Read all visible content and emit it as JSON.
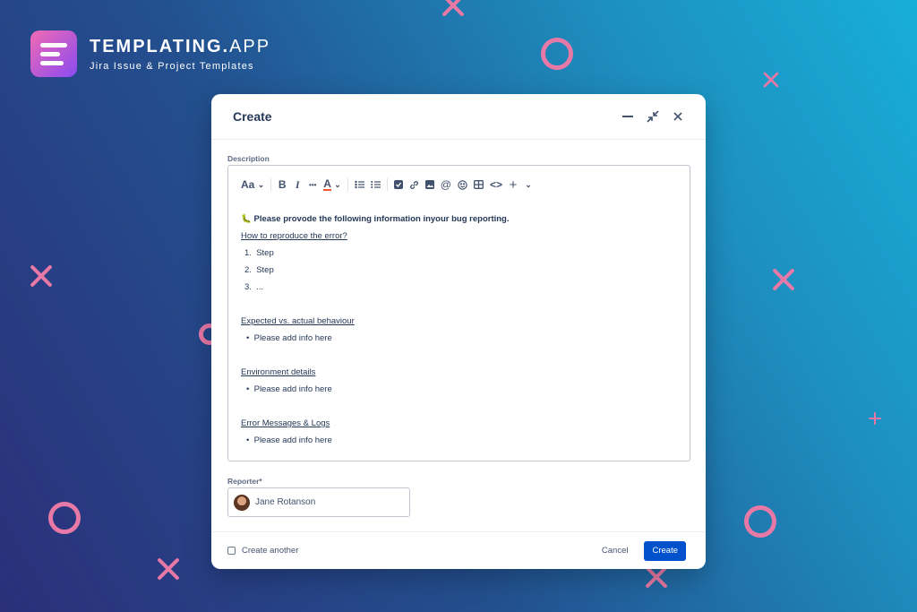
{
  "brand": {
    "name_bold": "TEMPLATING.",
    "name_light": "APP",
    "subtitle": "Jira Issue & Project Templates"
  },
  "modal": {
    "title": "Create",
    "description_label": "Description",
    "toolbar": {
      "text_style": "Aa",
      "bold": "B",
      "italic": "I",
      "more": "•••",
      "text_color": "A",
      "insert": "+",
      "code": "<>",
      "mention": "@"
    },
    "content": {
      "intro_emoji": "🐛",
      "intro": "Please provode the following information inyour bug reporting.",
      "h1": "How to reproduce the error?",
      "steps": [
        "Step",
        "Step",
        "..."
      ],
      "h2": "Expected vs. actual behaviour",
      "b2": "Please add info here",
      "h3": "Environment details",
      "b3": "Please add info here",
      "h4": "Error Messages & Logs",
      "b4": "Please add info here"
    },
    "reporter_label": "Reporter*",
    "reporter_name": "Jane Rotanson",
    "footer": {
      "create_another": "Create another",
      "cancel": "Cancel",
      "create": "Create"
    }
  },
  "colors": {
    "accent": "#0052cc",
    "decoration": "#e879a6"
  }
}
